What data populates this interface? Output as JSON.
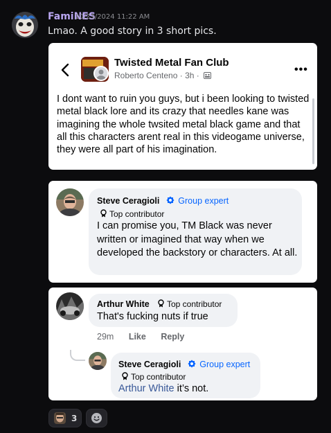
{
  "message": {
    "author": "FamiNES",
    "timestamp": "10/23/2024 11:22 AM",
    "text": "Lmao. A good story in 3 short pics.",
    "author_color": "#b9a6f0"
  },
  "card1": {
    "group_name": "Twisted Metal Fan Club",
    "poster": "Roberto Centeno",
    "age": "3h",
    "post_text": "I dont want to ruin you guys, but i been looking to twisted metal black lore and its crazy that needles kane was imagining the whole twsited metal black game and that all this characters arent real in this videogame universe, they were all part of his imagination."
  },
  "card2": {
    "name": "Steve Ceragioli",
    "expert_label": "Group expert",
    "badge": "Top contributor",
    "text": "I can promise you, TM Black was never written or imagined that way when we developed the backstory or characters. At all."
  },
  "card3": {
    "name": "Arthur White",
    "badge": "Top contributor",
    "text": "That's fucking nuts if true",
    "time": "29m",
    "like_label": "Like",
    "reply_label": "Reply",
    "reply": {
      "name": "Steve Ceragioli",
      "expert_label": "Group expert",
      "badge": "Top contributor",
      "mention": "Arthur White",
      "text": " it’s not."
    }
  },
  "reactions": {
    "count": "3"
  },
  "colors": {
    "background": "#0c0c0e",
    "fb_blue": "#0866ff",
    "bubble": "#f0f2f5"
  }
}
